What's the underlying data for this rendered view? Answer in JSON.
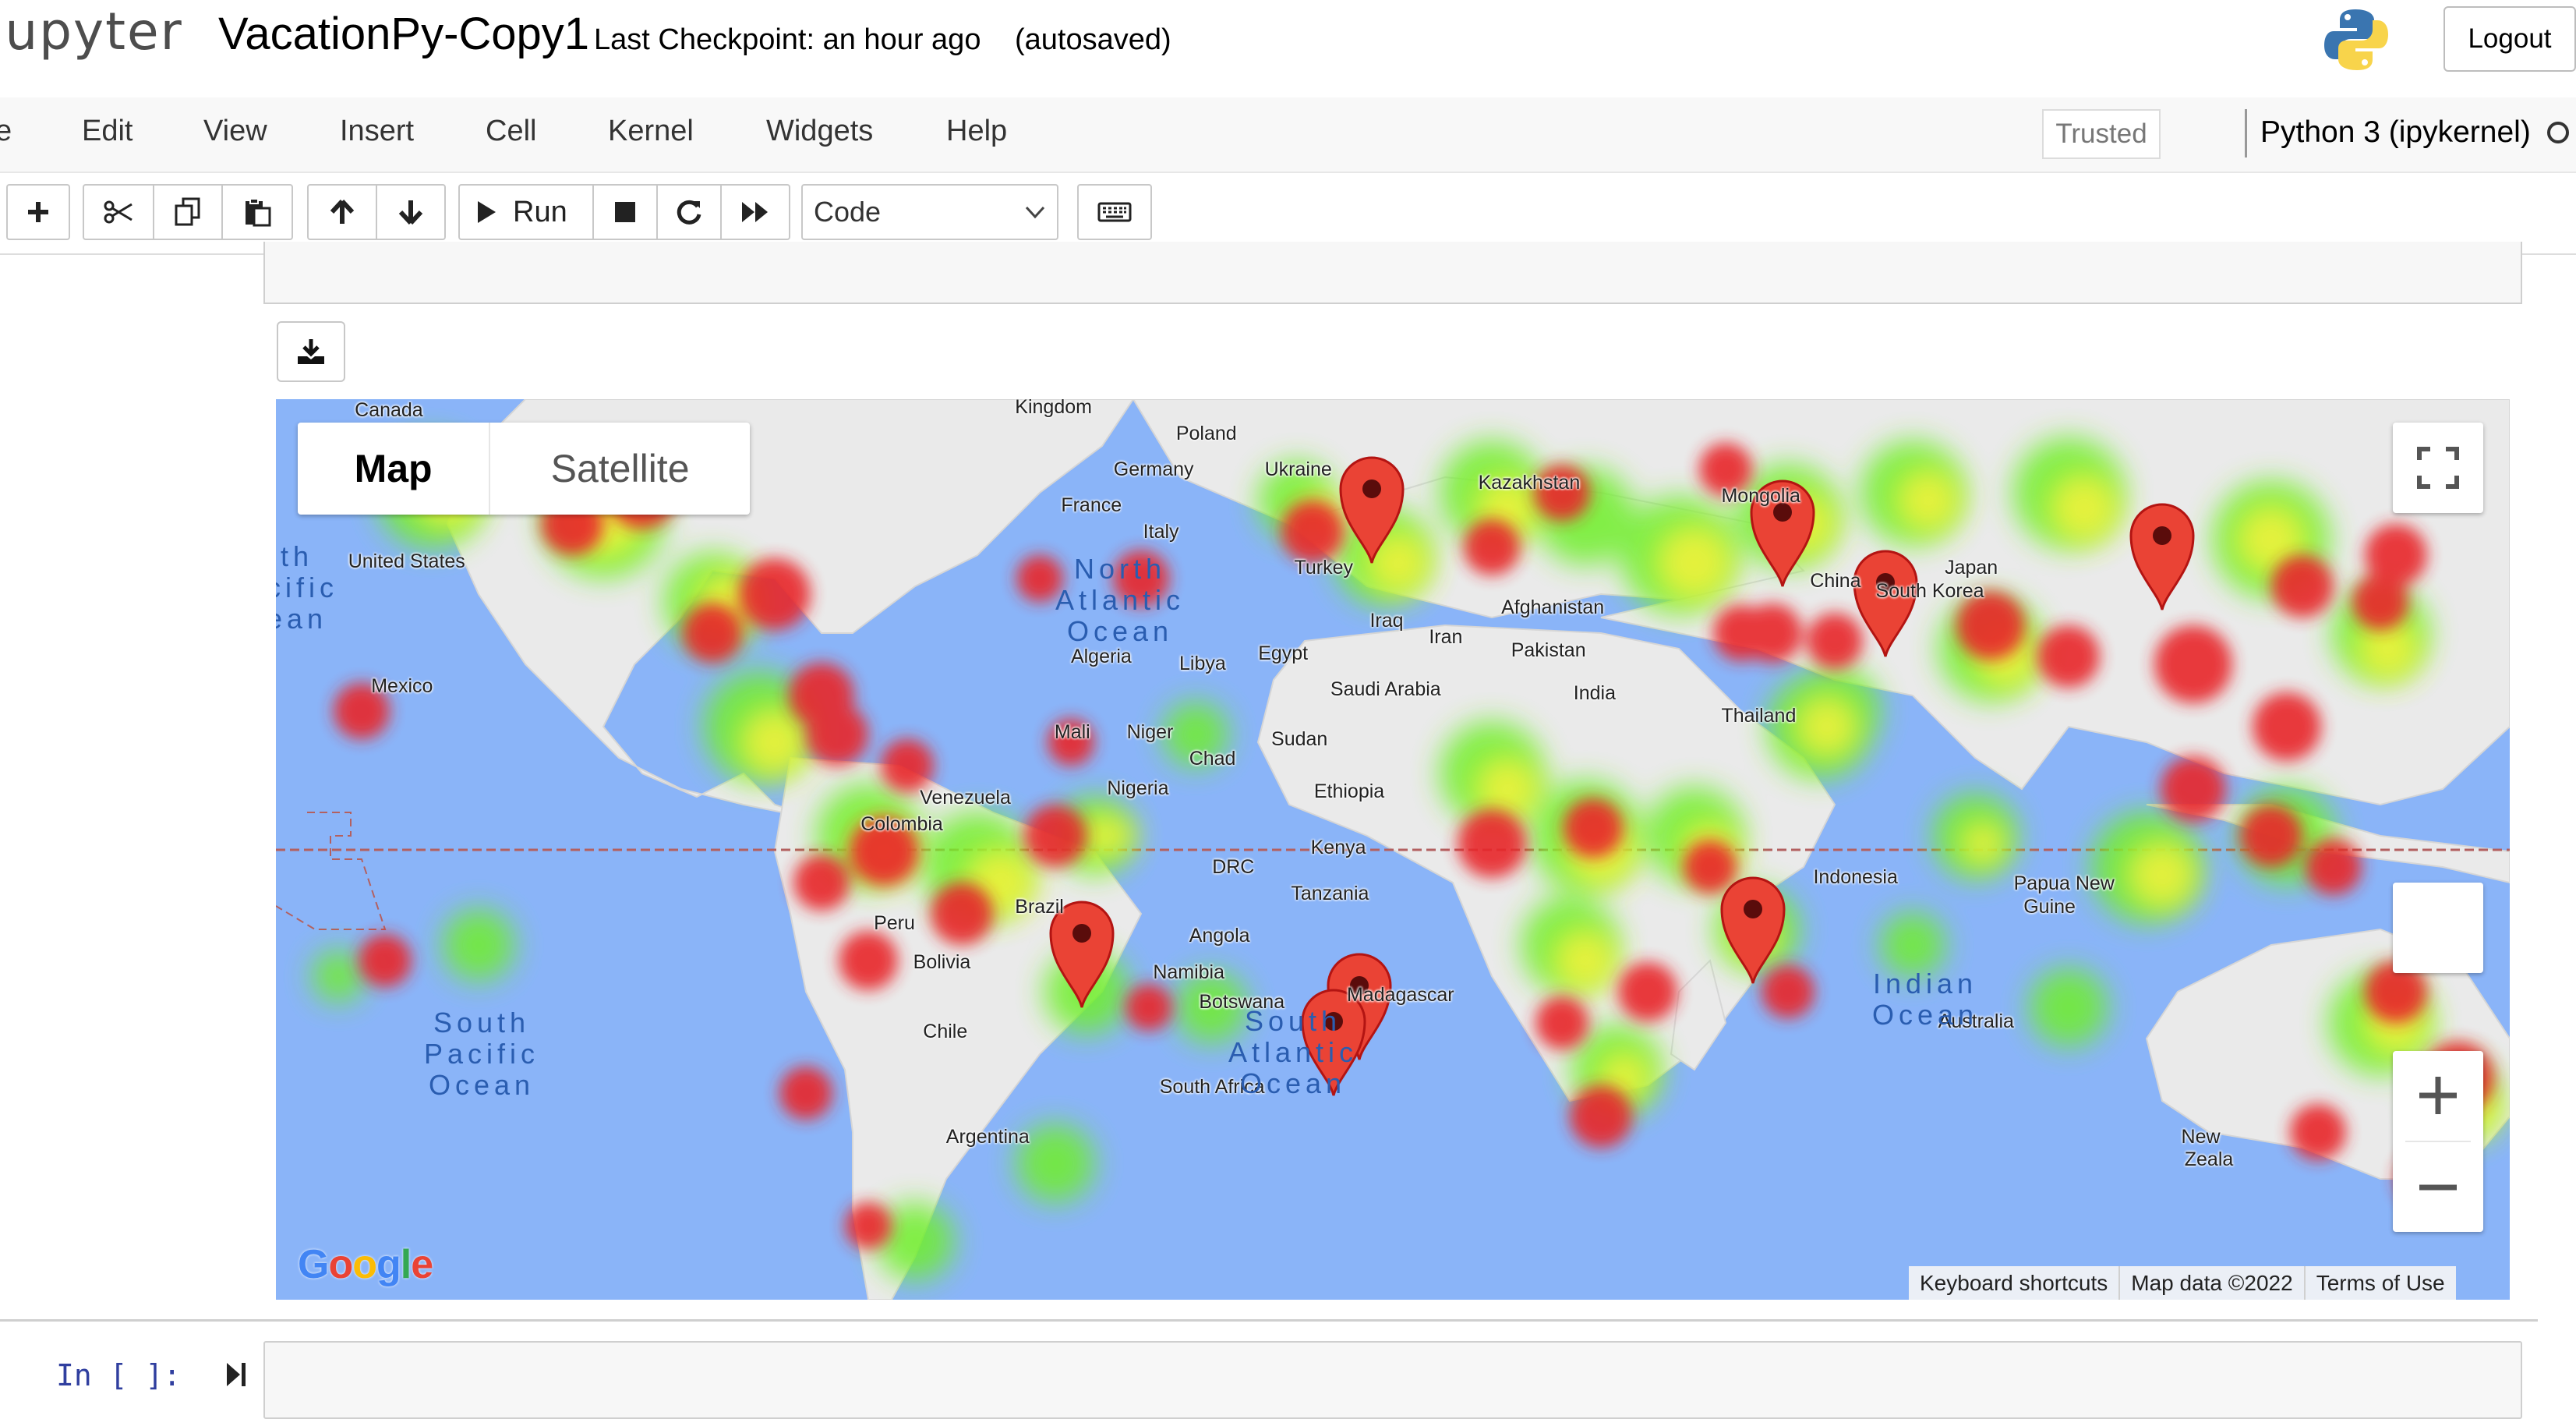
{
  "header": {
    "logo_text": "jupyter",
    "notebook_name": "VacationPy-Copy1",
    "checkpoint": "Last Checkpoint: an hour ago",
    "autosave_status": "(autosaved)",
    "logout_label": "Logout"
  },
  "menubar": {
    "items": [
      "e",
      "Edit",
      "View",
      "Insert",
      "Cell",
      "Kernel",
      "Widgets",
      "Help"
    ],
    "trusted_label": "Trusted",
    "kernel_name": "Python 3 (ipykernel)"
  },
  "toolbar": {
    "run_label": "Run",
    "cell_type": "Code",
    "icons": [
      "plus-icon",
      "cut-icon",
      "copy-icon",
      "paste-icon",
      "arrow-up-icon",
      "arrow-down-icon",
      "run-icon",
      "stop-icon",
      "restart-icon",
      "fast-forward-icon",
      "keyboard-icon"
    ]
  },
  "map": {
    "type_buttons": {
      "map": "Map",
      "satellite": "Satellite"
    },
    "land_labels": [
      "Canada",
      "Kingdom",
      "Poland",
      "Ukraine",
      "Germany",
      "Kazakhstan",
      "Mongolia",
      "France",
      "Italy",
      "United States",
      "Turkey",
      "Japan",
      "China",
      "South Korea",
      "Iraq",
      "Iran",
      "Afghanistan",
      "Pakistan",
      "Algeria",
      "Libya",
      "Egypt",
      "Mexico",
      "Saudi Arabia",
      "India",
      "Thailand",
      "Mali",
      "Niger",
      "Sudan",
      "Chad",
      "Venezuela",
      "Nigeria",
      "Ethiopia",
      "Colombia",
      "DRC",
      "Kenya",
      "Indonesia",
      "Tanzania",
      "Papua New",
      "Guine",
      "Peru",
      "Brazil",
      "Angola",
      "Bolivia",
      "Namibia",
      "Botswana",
      "Madagascar",
      "Chile",
      "Australia",
      "South Africa",
      "Argentina",
      "New",
      "Zeala"
    ],
    "ocean_labels": {
      "north_pacific": "rth\ncific\nean",
      "north_atlantic": "North\nAtlantic\nOcean",
      "south_pacific": "South\nPacific\nOcean",
      "south_atlantic": "South\nAtlantic\nOcean",
      "indian": "Indian\nOcean"
    },
    "google_logo": "Google",
    "attribution": [
      "Keyboard shortcuts",
      "Map data ©2022",
      "Terms of Use"
    ],
    "colors": {
      "ocean": "#8ab4f8",
      "land": "#eaeaea",
      "heat_low": "#7cff2f",
      "heat_mid": "#f2f23a",
      "heat_high": "#e8262b",
      "marker": "#ea4335"
    }
  },
  "cell": {
    "prompt": "In [ ]:"
  }
}
